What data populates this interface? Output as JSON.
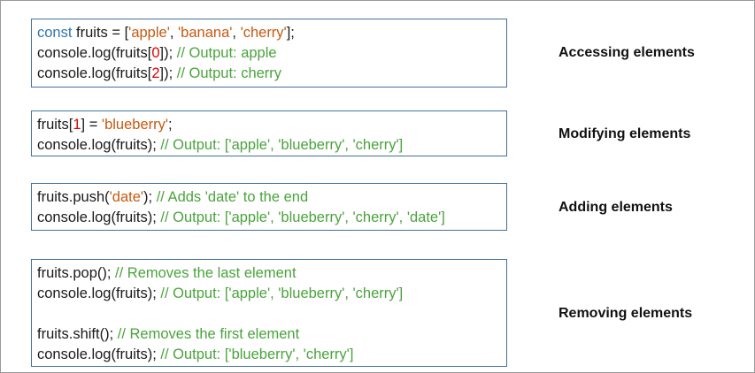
{
  "blocks": [
    {
      "label": "Accessing elements",
      "lines": [
        {
          "parts": [
            {
              "k": "kw",
              "t": "const"
            },
            {
              "k": "txt",
              "t": " fruits = ["
            },
            {
              "k": "str",
              "t": "'apple'"
            },
            {
              "k": "txt",
              "t": ", "
            },
            {
              "k": "str",
              "t": "'banana'"
            },
            {
              "k": "txt",
              "t": ", "
            },
            {
              "k": "str",
              "t": "'cherry'"
            },
            {
              "k": "txt",
              "t": "];"
            }
          ]
        },
        {
          "parts": [
            {
              "k": "txt",
              "t": "console.log(fruits["
            },
            {
              "k": "num",
              "t": "0"
            },
            {
              "k": "txt",
              "t": "]); "
            },
            {
              "k": "cmt",
              "t": "// Output: apple"
            }
          ]
        },
        {
          "parts": [
            {
              "k": "txt",
              "t": "console.log(fruits["
            },
            {
              "k": "num",
              "t": "2"
            },
            {
              "k": "txt",
              "t": "]); "
            },
            {
              "k": "cmt",
              "t": "// Output: cherry"
            }
          ]
        }
      ]
    },
    {
      "label": "Modifying elements",
      "lines": [
        {
          "parts": [
            {
              "k": "txt",
              "t": "fruits["
            },
            {
              "k": "num",
              "t": "1"
            },
            {
              "k": "txt",
              "t": "] = "
            },
            {
              "k": "str",
              "t": "'blueberry'"
            },
            {
              "k": "txt",
              "t": ";"
            }
          ]
        },
        {
          "parts": [
            {
              "k": "txt",
              "t": "console.log(fruits); "
            },
            {
              "k": "cmt",
              "t": "// Output: ['apple', 'blueberry', 'cherry']"
            }
          ]
        }
      ]
    },
    {
      "label": "Adding elements",
      "lines": [
        {
          "parts": [
            {
              "k": "txt",
              "t": "fruits.push("
            },
            {
              "k": "str",
              "t": "'date'"
            },
            {
              "k": "txt",
              "t": "); "
            },
            {
              "k": "cmt",
              "t": "// Adds 'date' to the end"
            }
          ]
        },
        {
          "parts": [
            {
              "k": "txt",
              "t": "console.log(fruits); "
            },
            {
              "k": "cmt",
              "t": "// Output: ['apple', 'blueberry', 'cherry', 'date']"
            }
          ]
        }
      ]
    },
    {
      "label": "Removing elements",
      "lines": [
        {
          "parts": [
            {
              "k": "txt",
              "t": "fruits.pop(); "
            },
            {
              "k": "cmt",
              "t": "// Removes the last element"
            }
          ]
        },
        {
          "parts": [
            {
              "k": "txt",
              "t": "console.log(fruits); "
            },
            {
              "k": "cmt",
              "t": "// Output: ['apple', 'blueberry', 'cherry']"
            }
          ]
        },
        {
          "parts": []
        },
        {
          "parts": [
            {
              "k": "txt",
              "t": "fruits.shift(); "
            },
            {
              "k": "cmt",
              "t": "// Removes the first element"
            }
          ]
        },
        {
          "parts": [
            {
              "k": "txt",
              "t": "console.log(fruits); "
            },
            {
              "k": "cmt",
              "t": "// Output: ['blueberry', 'cherry']"
            }
          ]
        }
      ]
    }
  ],
  "colors": {
    "keyword": "#2e74b5",
    "string": "#c55a11",
    "number": "#e00000",
    "comment": "#4aa33c",
    "box_border": "#41719c"
  }
}
